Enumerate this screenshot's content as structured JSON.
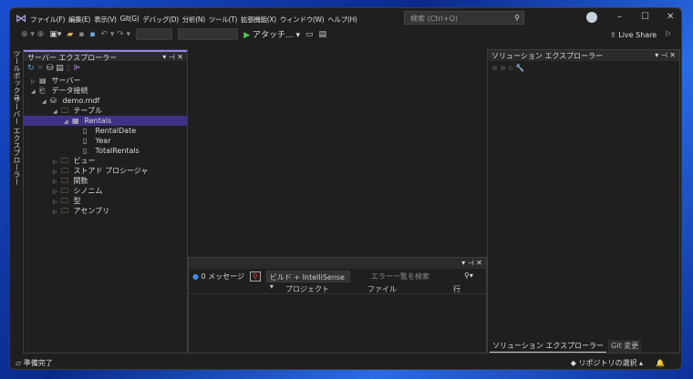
{
  "menu": [
    "ファイル(F)",
    "編集(E)",
    "表示(V)",
    "Git(G)",
    "デバッグ(D)",
    "分析(N)",
    "ツール(T)",
    "拡張機能(X)",
    "ウィンドウ(W)",
    "ヘルプ(H)"
  ],
  "search": {
    "placeholder": "検索 (Ctrl+Q)"
  },
  "toolbar": {
    "attach": "アタッチ...",
    "live_share": "Live Share"
  },
  "left_tabs": [
    "ツールボックス",
    "サーバー エクスプローラー"
  ],
  "server_explorer": {
    "title": "サーバー エクスプローラー",
    "tree": [
      {
        "label": "サーバー",
        "level": 0,
        "expand": "▷",
        "icon": "server-icon"
      },
      {
        "label": "データ接続",
        "level": 0,
        "expand": "◢",
        "icon": "data-connection-icon"
      },
      {
        "label": "demo.mdf",
        "level": 1,
        "expand": "◢",
        "icon": "database-icon"
      },
      {
        "label": "テーブル",
        "level": 2,
        "expand": "◢",
        "icon": "folder-icon"
      },
      {
        "label": "Rentals",
        "level": 3,
        "expand": "◢",
        "icon": "table-icon",
        "selected": true
      },
      {
        "label": "RentalDate",
        "level": 4,
        "expand": "",
        "icon": "column-icon"
      },
      {
        "label": "Year",
        "level": 4,
        "expand": "",
        "icon": "column-icon"
      },
      {
        "label": "TotalRentals",
        "level": 4,
        "expand": "",
        "icon": "column-icon"
      },
      {
        "label": "ビュー",
        "level": 2,
        "expand": "▷",
        "icon": "folder-icon"
      },
      {
        "label": "ストアド プロシージャ",
        "level": 2,
        "expand": "▷",
        "icon": "folder-icon"
      },
      {
        "label": "関数",
        "level": 2,
        "expand": "▷",
        "icon": "folder-icon"
      },
      {
        "label": "シノニム",
        "level": 2,
        "expand": "▷",
        "icon": "folder-icon"
      },
      {
        "label": "型",
        "level": 2,
        "expand": "▷",
        "icon": "folder-icon"
      },
      {
        "label": "アセンブリ",
        "level": 2,
        "expand": "▷",
        "icon": "folder-icon"
      }
    ]
  },
  "error_list": {
    "messages": "0 メッセージ",
    "filter": "ビルド + IntelliSense",
    "search_placeholder": "エラー一覧を検索",
    "columns": [
      "プロジェクト",
      "ファイル",
      "行"
    ]
  },
  "solution_explorer": {
    "title": "ソリューション エクスプローラー",
    "tabs": [
      "ソリューション エクスプローラー",
      "Git 変更"
    ]
  },
  "status": {
    "text": "準備完了",
    "repo": "リポジトリの選択"
  },
  "colors": {
    "accent": "#9184ee",
    "selection": "#3e3286"
  }
}
